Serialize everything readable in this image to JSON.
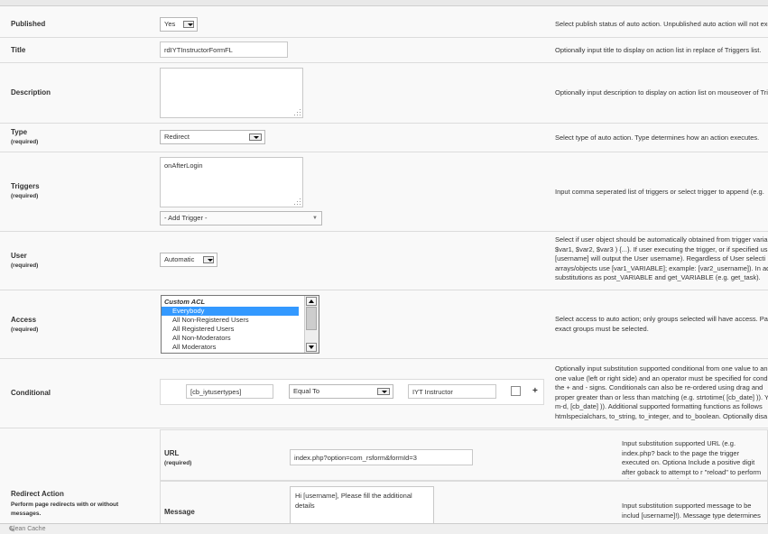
{
  "rows": {
    "published": {
      "label": "Published",
      "value": "Yes",
      "desc": "Select publish status of auto action. Unpublished auto action will not exe"
    },
    "title": {
      "label": "Title",
      "value": "rdIYTInstructorFormFL",
      "desc": "Optionally input title to display on action list in replace of Triggers list."
    },
    "description": {
      "label": "Description",
      "value": "",
      "desc": "Optionally input description to display on action list on mouseover of Tri"
    },
    "type": {
      "label": "Type",
      "required": "(required)",
      "value": "Redirect",
      "desc": "Select type of auto action. Type determines how an action executes."
    },
    "triggers": {
      "label": "Triggers",
      "required": "(required)",
      "value": "onAfterLogin",
      "add_trigger": "- Add Trigger -",
      "desc": "Input comma seperated list of triggers or select trigger to append (e.g."
    },
    "user": {
      "label": "User",
      "required": "(required)",
      "value": "Automatic",
      "desc": "Select if user object should be automatically obtained from trigger varia $var1, $var2, $var3 ) {...}. If user executing the trigger, or if specified us [username] will output the User username). Regardless of User selecti arrays/objects use [var1_VARIABLE]; example: [var2_username]). In ad substitutions as post_VARIABLE and get_VARIABLE (e.g. get_task)."
    },
    "access": {
      "label": "Access",
      "required": "(required)",
      "group": "Custom ACL",
      "options": [
        "Everybody",
        "All Non-Registered Users",
        "All Registered Users",
        "All Non-Moderators",
        "All Moderators"
      ],
      "desc": "Select access to auto action; only groups selected will have access. Pa exact groups must be selected."
    },
    "conditional": {
      "label": "Conditional",
      "field": "[cb_iytusertypes]",
      "operator": "Equal To",
      "value": "IYT Instructor",
      "add": "+",
      "desc": "Optionally input substitution supported conditional from one value to ano one value (left or right side) and an operator must be specified for cond the + and - signs. Conditionals can also be re-ordered using drag and proper greater than or less than matching (e.g. strtotime( [cb_date] )). Y-m-d, [cb_date] )). Additional supported formatting functions as follows htmlspecialchars, to_string, to_integer, and to_boolean. Optionally disa"
    },
    "redirect": {
      "label": "Redirect Action",
      "sublabel": "Perform page redirects with or without messages.",
      "url": {
        "label": "URL",
        "required": "(required)",
        "value": "index.php?option=com_rsform&formId=3",
        "desc": "Input substitution supported URL (e.g. index.php? back to the page the trigger executed on. Optiona Include a positive digit after goback to attempt to r \"reload\" to perform a browser page refresh."
      },
      "message": {
        "label": "Message",
        "value": "Hi [username], Please fill the additional details",
        "desc": "Input substitution supported message to be includ [username]!). Message type determines display o"
      }
    }
  },
  "statusbar": {
    "text": "Clean Cache"
  }
}
